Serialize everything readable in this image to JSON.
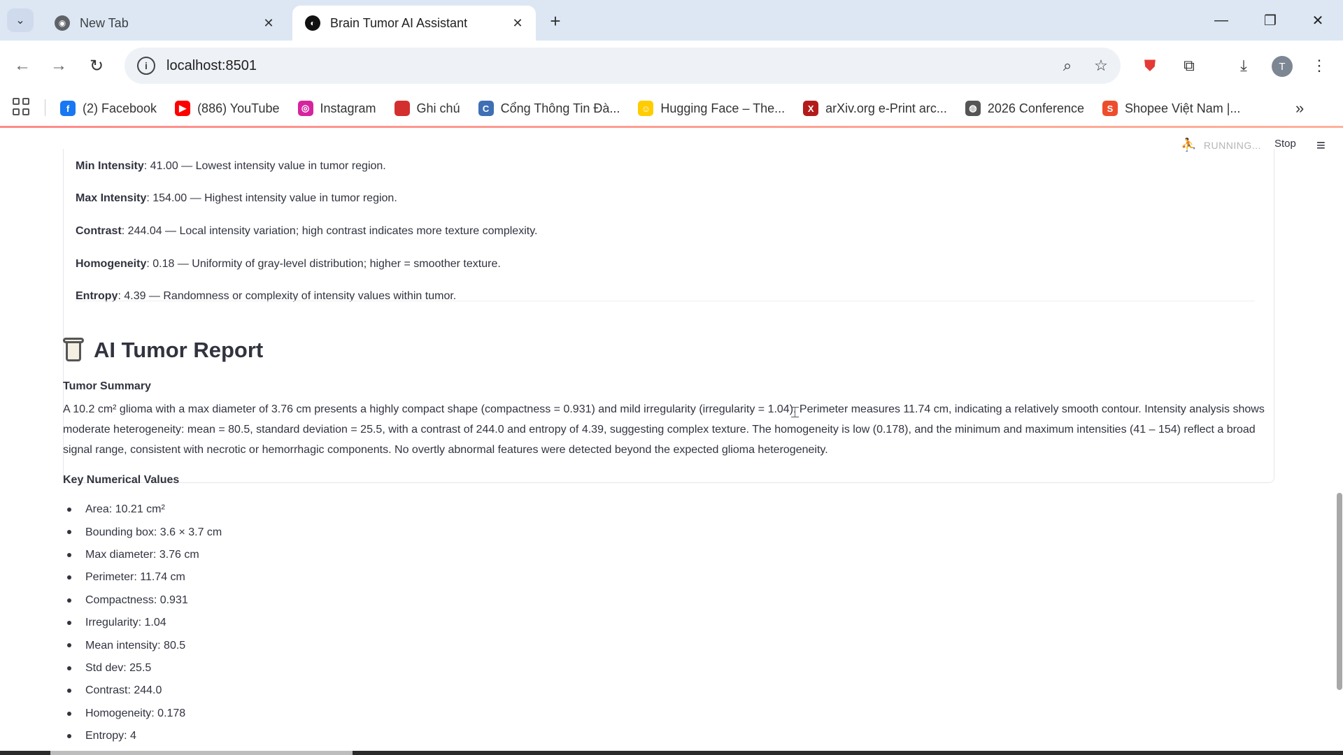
{
  "browser": {
    "tabs": [
      {
        "title": "New Tab",
        "active": false
      },
      {
        "title": "Brain Tumor AI Assistant",
        "active": true
      }
    ],
    "url": "localhost:8501",
    "avatar_letter": "T",
    "bookmarks": [
      {
        "label": "(2) Facebook",
        "icon": "facebook-icon",
        "color": "#1877f2",
        "glyph": "f"
      },
      {
        "label": "(886) YouTube",
        "icon": "youtube-icon",
        "color": "#ff0000",
        "glyph": "▶"
      },
      {
        "label": "Instagram",
        "icon": "instagram-icon",
        "color": "#d6249f",
        "glyph": "◎"
      },
      {
        "label": "Ghi chú",
        "icon": "notes-icon",
        "color": "#d32f2f",
        "glyph": ""
      },
      {
        "label": "Cổng Thông Tin Đà...",
        "icon": "portal-icon",
        "color": "#3f6fb5",
        "glyph": "C"
      },
      {
        "label": "Hugging Face – The...",
        "icon": "huggingface-icon",
        "color": "#ffcc00",
        "glyph": "☺"
      },
      {
        "label": "arXiv.org e-Print arc...",
        "icon": "arxiv-icon",
        "color": "#b31b1b",
        "glyph": "X"
      },
      {
        "label": "2026 Conference",
        "icon": "globe-icon",
        "color": "#555555",
        "glyph": "◍"
      },
      {
        "label": "Shopee Việt Nam |...",
        "icon": "shopee-icon",
        "color": "#ee4d2d",
        "glyph": "S"
      }
    ]
  },
  "app_header": {
    "status": "RUNNING...",
    "stop_label": "Stop"
  },
  "metrics": [
    {
      "name": "Min Intensity",
      "value": "41.00",
      "desc": " — Lowest intensity value in tumor region."
    },
    {
      "name": "Max Intensity",
      "value": "154.00",
      "desc": " — Highest intensity value in tumor region."
    },
    {
      "name": "Contrast",
      "value": "244.04",
      "desc": " — Local intensity variation; high contrast indicates more texture complexity."
    },
    {
      "name": "Homogeneity",
      "value": "0.18",
      "desc": " — Uniformity of gray-level distribution; higher = smoother texture."
    },
    {
      "name": "Entropy",
      "value": "4.39",
      "desc": " — Randomness or complexity of intensity values within tumor."
    }
  ],
  "report": {
    "title": "AI Tumor Report",
    "summary_heading": "Tumor Summary",
    "summary_text": "A 10.2 cm² glioma with a max diameter of 3.76 cm presents a highly compact shape (compactness = 0.931) and mild irregularity (irregularity = 1.04). Perimeter measures 11.74 cm, indicating a relatively smooth contour. Intensity analysis shows moderate heterogeneity: mean = 80.5, standard deviation = 25.5, with a contrast of 244.0 and entropy of 4.39, suggesting complex texture. The homogeneity is low (0.178), and the minimum and maximum intensities (41 – 154) reflect a broad signal range, consistent with necrotic or hemorrhagic components. No overtly abnormal features were detected beyond the expected glioma heterogeneity.",
    "key_heading": "Key Numerical Values",
    "key_values": [
      "Area: 10.21 cm²",
      "Bounding box: 3.6 × 3.7 cm",
      "Max diameter: 3.76 cm",
      "Perimeter: 11.74 cm",
      "Compactness: 0.931",
      "Irregularity: 1.04",
      "Mean intensity: 80.5",
      "Std dev: 25.5",
      "Contrast: 244.0",
      "Homogeneity: 0.178",
      "Entropy: 4"
    ]
  }
}
